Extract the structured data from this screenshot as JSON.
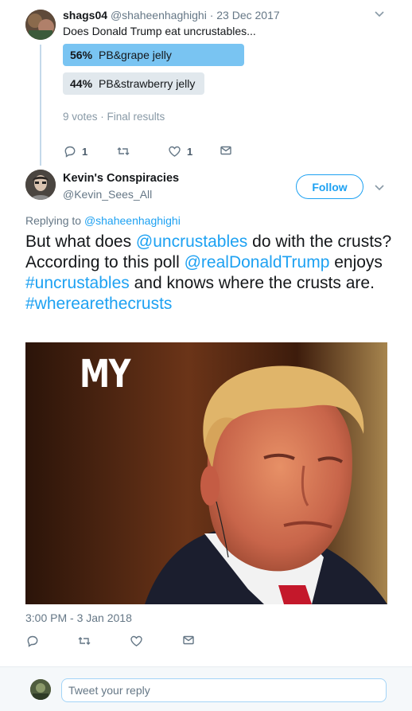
{
  "parent_tweet": {
    "display_name": "shags04",
    "handle": "@shaheenhaghighi",
    "separator": "·",
    "date": "23 Dec 2017",
    "text": "Does Donald Trump eat uncrustables...",
    "poll": [
      {
        "percent": "56%",
        "label": "PB&grape jelly",
        "share": 56,
        "leading": true
      },
      {
        "percent": "44%",
        "label": "PB&strawberry jelly",
        "share": 44,
        "leading": false
      }
    ],
    "poll_meta": "9 votes · Final results",
    "actions": {
      "reply_count": "1",
      "retweet_count": "",
      "like_count": "1"
    }
  },
  "main_tweet": {
    "display_name": "Kevin's Conspiracies",
    "handle": "@Kevin_Sees_All",
    "follow_label": "Follow",
    "replying_prefix": "Replying to",
    "replying_handle": "@shaheenhaghighi",
    "text_segments": [
      {
        "text": "But what does ",
        "type": "plain"
      },
      {
        "text": "@uncrustables",
        "type": "link"
      },
      {
        "text": " do with the crusts? According to this poll ",
        "type": "plain"
      },
      {
        "text": "@realDonaldTrump",
        "type": "link"
      },
      {
        "text": " enjoys ",
        "type": "plain"
      },
      {
        "text": "#uncrustables",
        "type": "link"
      },
      {
        "text": " and knows where the crusts are. ",
        "type": "plain"
      },
      {
        "text": "#wherearethecrusts",
        "type": "link"
      }
    ],
    "media_caption": "MY",
    "timestamp": "3:00 PM - 3 Jan 2018"
  },
  "reply_box": {
    "placeholder": "Tweet your reply"
  },
  "icons": {
    "caret": "chevron-down-icon",
    "reply": "reply-icon",
    "retweet": "retweet-icon",
    "like": "heart-icon",
    "dm": "envelope-icon"
  },
  "colors": {
    "accent": "#1da1f2",
    "poll_leading": "#79c4f2",
    "poll_other": "#e1e8ed",
    "muted": "#657786"
  }
}
